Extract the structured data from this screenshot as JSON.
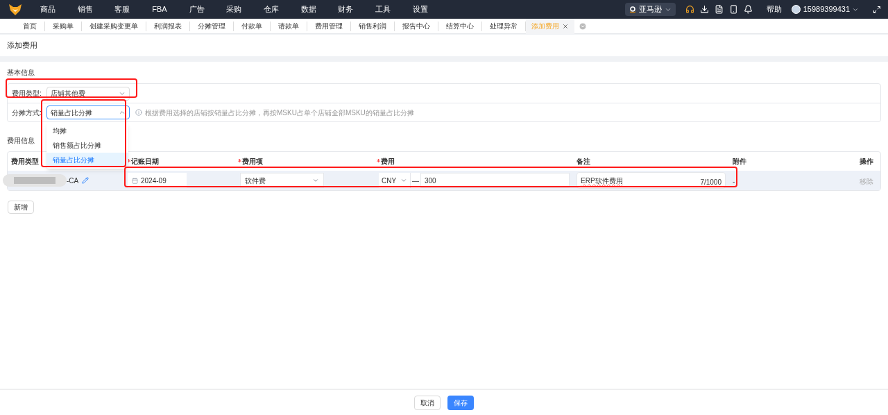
{
  "nav": {
    "menu": [
      "商品",
      "销售",
      "客服",
      "FBA",
      "广告",
      "采购",
      "仓库",
      "数据",
      "财务",
      "工具",
      "设置"
    ],
    "store": "亚马逊",
    "help": "帮助",
    "user": "15989399431"
  },
  "tabs": [
    {
      "label": "首页",
      "selected": false
    },
    {
      "label": "采购单",
      "selected": false
    },
    {
      "label": "创建采购变更单",
      "selected": false
    },
    {
      "label": "利润报表",
      "selected": false
    },
    {
      "label": "分摊管理",
      "selected": false
    },
    {
      "label": "付款单",
      "selected": false
    },
    {
      "label": "请款单",
      "selected": false
    },
    {
      "label": "费用管理",
      "selected": false
    },
    {
      "label": "销售利润",
      "selected": false
    },
    {
      "label": "报告中心",
      "selected": false
    },
    {
      "label": "结算中心",
      "selected": false
    },
    {
      "label": "处理异常",
      "selected": false
    },
    {
      "label": "添加费用",
      "selected": true
    }
  ],
  "page_title": "添加费用",
  "basic": {
    "title": "基本信息",
    "fields": [
      {
        "label": "费用类型:",
        "value": "店铺其他费",
        "open": false
      },
      {
        "label": "分摊方式:",
        "value": "销量占比分摊",
        "open": true,
        "hint": "根据费用选择的店铺按销量占比分摊，再按MSKU占单个店铺全部MSKU的销量占比分摊"
      }
    ],
    "options": [
      {
        "label": "均摊",
        "selected": false
      },
      {
        "label": "销售额占比分摊",
        "selected": false
      },
      {
        "label": "销量占比分摊",
        "selected": true
      }
    ]
  },
  "costs": {
    "title": "费用信息",
    "columns": [
      {
        "label": "费用类型",
        "required": false
      },
      {
        "label": "记账日期",
        "required": true
      },
      {
        "label": "费用项",
        "required": true
      },
      {
        "label": "费用",
        "required": true
      },
      {
        "label": "备注",
        "required": false
      },
      {
        "label": "附件",
        "required": false
      },
      {
        "label": "操作",
        "required": false
      }
    ],
    "rows": [
      {
        "type": "-CA",
        "date": "2024-09",
        "item": "软件费",
        "currency": "CNY",
        "separator": "—",
        "amount": "300",
        "note": "ERP软件费用",
        "count": "7/1000",
        "attachment": "-",
        "action": "移除"
      }
    ],
    "add": "新增"
  },
  "footer": {
    "cancel": "取消",
    "save": "保存"
  }
}
